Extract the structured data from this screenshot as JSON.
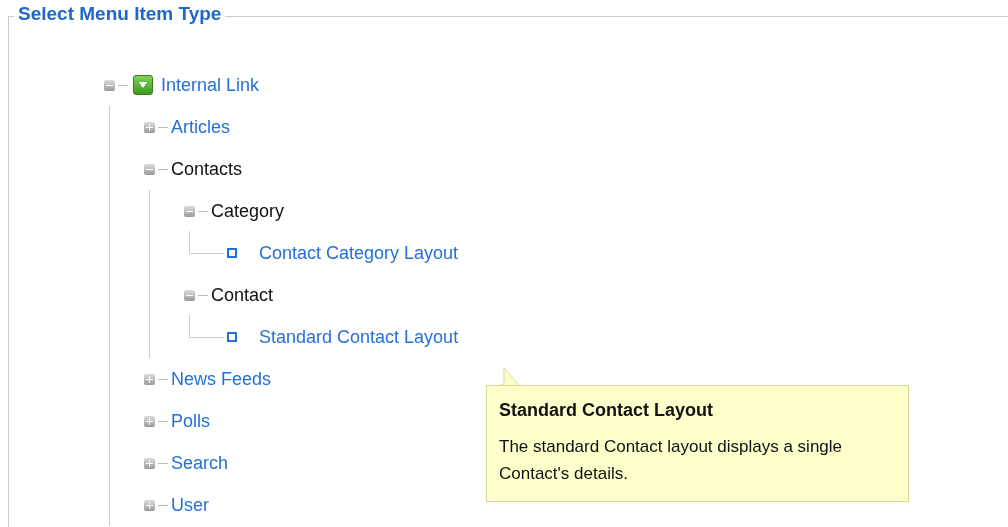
{
  "panel": {
    "title": "Select Menu Item Type"
  },
  "tree": [
    {
      "label": "Internal Link",
      "kind": "type",
      "expanded": true,
      "children": [
        {
          "label": "Articles",
          "kind": "group",
          "expanded": false
        },
        {
          "label": "Contacts",
          "kind": "group",
          "expanded": true,
          "children": [
            {
              "label": "Category",
              "kind": "group",
              "expanded": true,
              "children": [
                {
                  "label": "Contact Category Layout",
                  "kind": "layout"
                }
              ]
            },
            {
              "label": "Contact",
              "kind": "group",
              "expanded": true,
              "children": [
                {
                  "label": "Standard Contact Layout",
                  "kind": "layout"
                }
              ]
            }
          ]
        },
        {
          "label": "News Feeds",
          "kind": "group",
          "expanded": false
        },
        {
          "label": "Polls",
          "kind": "group",
          "expanded": false
        },
        {
          "label": "Search",
          "kind": "group",
          "expanded": false
        },
        {
          "label": "User",
          "kind": "group",
          "expanded": false
        }
      ]
    }
  ],
  "tooltip": {
    "title": "Standard Contact Layout",
    "text": "The standard Contact layout displays a single Contact's details."
  }
}
